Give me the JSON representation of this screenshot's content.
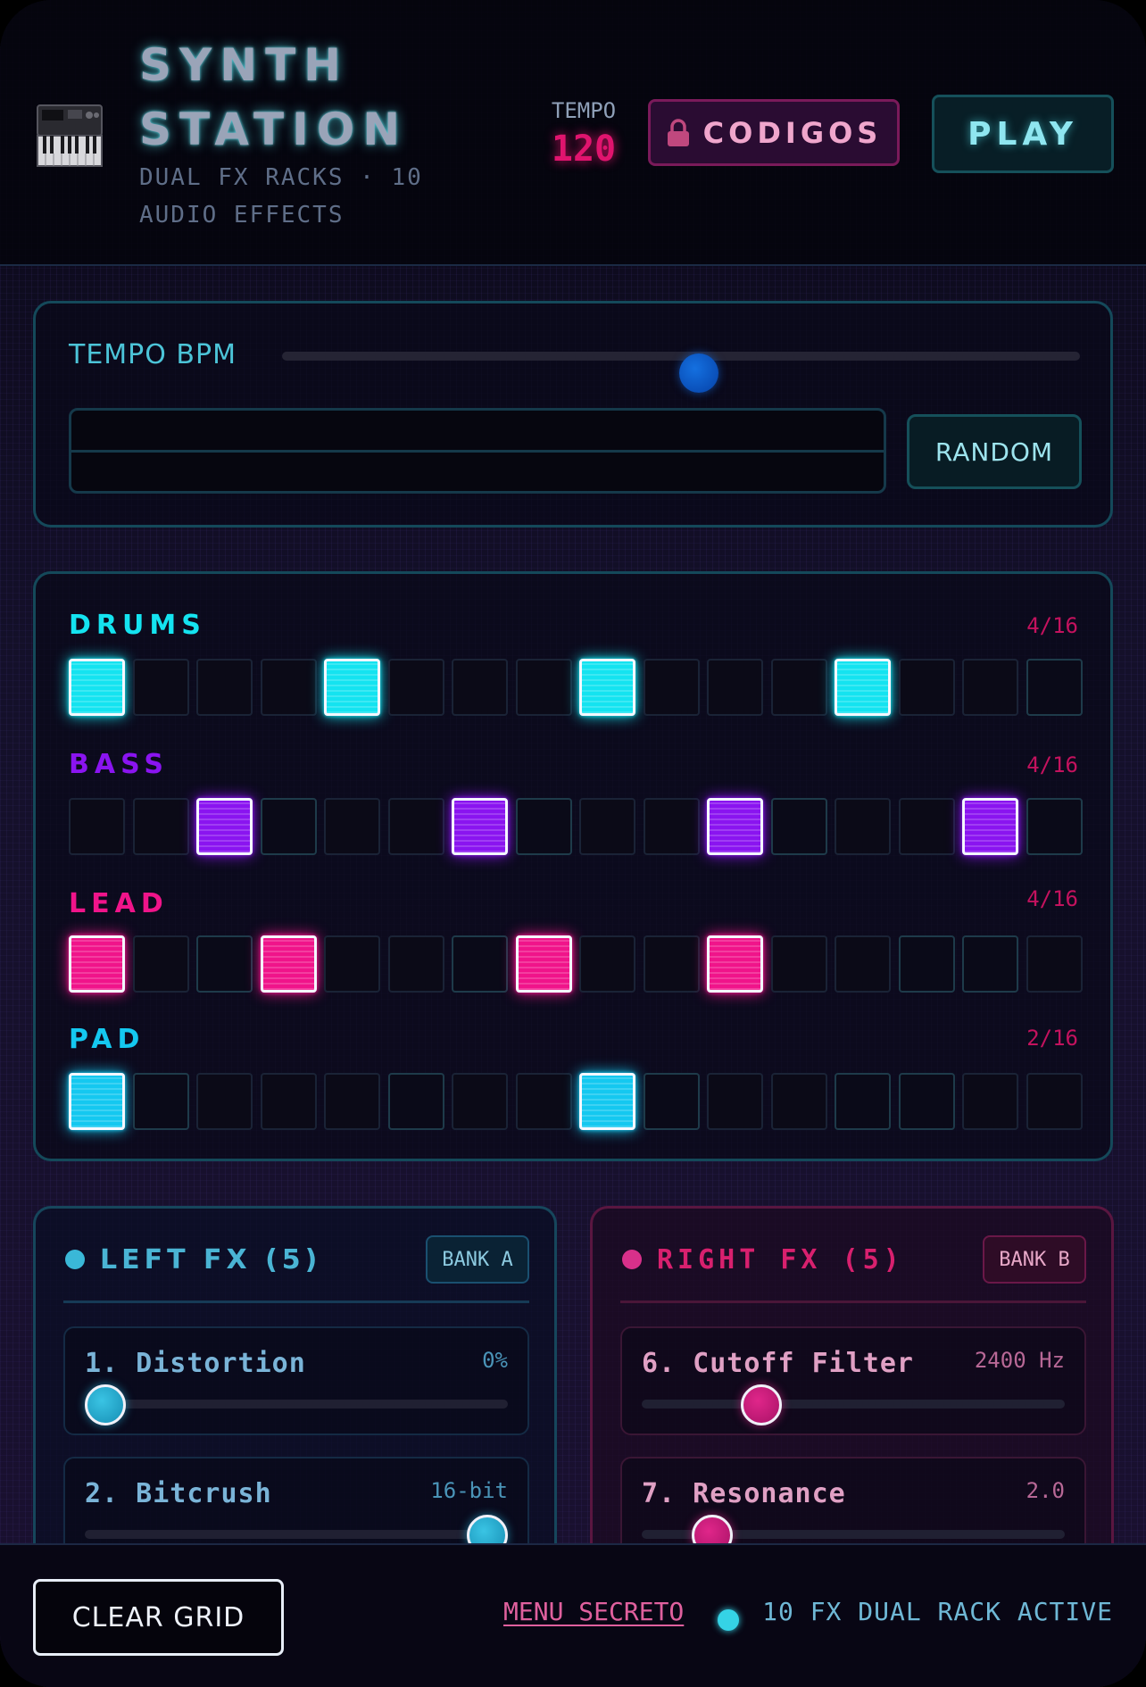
{
  "header": {
    "title_line1": "SYNTH",
    "title_line2": "STATION",
    "subtitle": "DUAL FX RACKS · 10 AUDIO EFFECTS",
    "tempo_label": "TEMPO",
    "tempo_value": "120",
    "codigos_label": "CODIGOS",
    "play_label": "PLAY",
    "logo_icon": "keyboard-synth-icon",
    "lock_icon": "lock-icon"
  },
  "tempo_panel": {
    "label": "TEMPO BPM",
    "slider_value_fraction": 0.5,
    "random_label": "RANDOM"
  },
  "sequencer": {
    "tracks": [
      {
        "name": "DRUMS",
        "count": "4/16",
        "color": "#14e3f0",
        "active": [
          0,
          4,
          8,
          12
        ]
      },
      {
        "name": "BASS",
        "count": "4/16",
        "color": "#8a14f0",
        "active": [
          2,
          6,
          10,
          14
        ]
      },
      {
        "name": "LEAD",
        "count": "4/16",
        "color": "#f0148a",
        "active": [
          0,
          3,
          7,
          10
        ]
      },
      {
        "name": "PAD",
        "count": "2/16",
        "color": "#14c8f0",
        "active": [
          0,
          8
        ]
      }
    ]
  },
  "left_fx": {
    "title": "LEFT FX (5)",
    "bank": "BANK A",
    "color": "#3ab8d8",
    "effects": [
      {
        "name": "1. Distortion",
        "value": "0%",
        "fraction": 0.0
      },
      {
        "name": "2. Bitcrush",
        "value": "16-bit",
        "fraction": 1.0
      }
    ]
  },
  "right_fx": {
    "title": "RIGHT FX (5)",
    "bank": "BANK B",
    "color": "#d8308a",
    "effects": [
      {
        "name": "6. Cutoff Filter",
        "value": "2400 Hz",
        "fraction": 0.26
      },
      {
        "name": "7. Resonance",
        "value": "2.0",
        "fraction": 0.13
      }
    ]
  },
  "footer": {
    "clear_grid_label": "CLEAR GRID",
    "menu_secreto_label": "MENU SECRETO",
    "status_text": "10 FX DUAL RACK ACTIVE"
  }
}
